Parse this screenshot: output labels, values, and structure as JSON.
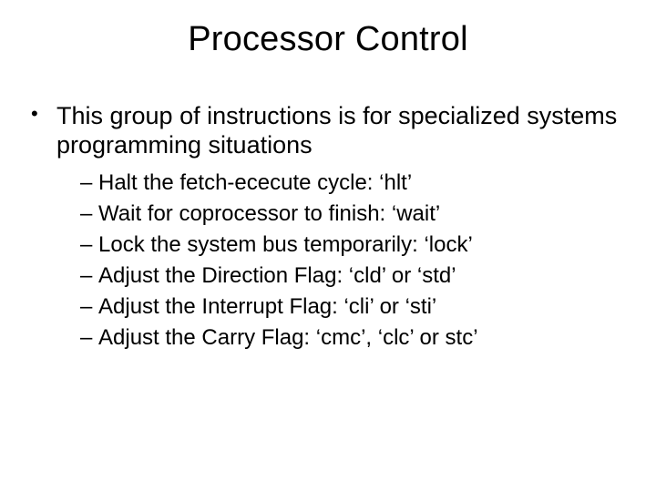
{
  "title": "Processor Control",
  "bullet": "This group of instructions is for specialized systems programming situations",
  "subs": [
    "Halt the fetch-ececute cycle: ‘hlt’",
    "Wait for coprocessor to finish: ‘wait’",
    "Lock the system bus temporarily: ‘lock’",
    "Adjust the Direction Flag: ‘cld’ or ‘std’",
    "Adjust the Interrupt Flag: ‘cli’ or ‘sti’",
    "Adjust the Carry Flag: ‘cmc’, ‘clc’ or stc’"
  ]
}
